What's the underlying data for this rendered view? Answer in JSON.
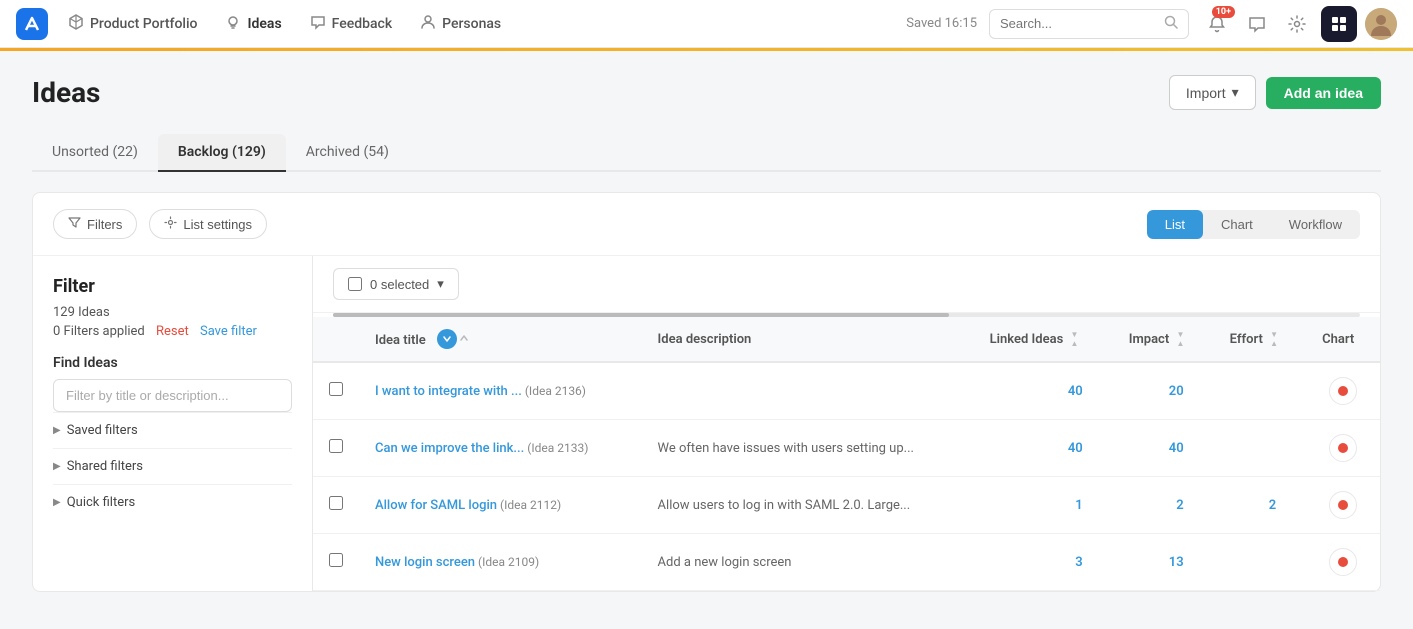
{
  "app": {
    "logo_label": "Aha",
    "nav_items": [
      {
        "label": "Product Portfolio",
        "icon": "cube-icon",
        "active": false
      },
      {
        "label": "Ideas",
        "icon": "bulb-icon",
        "active": true
      },
      {
        "label": "Feedback",
        "icon": "chat-icon",
        "active": false
      },
      {
        "label": "Personas",
        "icon": "person-icon",
        "active": false
      }
    ],
    "saved_text": "Saved 16:15",
    "search_placeholder": "Search...",
    "notification_badge": "10+",
    "user_avatar_alt": "User avatar"
  },
  "page": {
    "title": "Ideas",
    "btn_import": "Import",
    "btn_import_arrow": "▾",
    "btn_add_idea": "Add an idea"
  },
  "tabs": [
    {
      "label": "Unsorted (22)",
      "active": false
    },
    {
      "label": "Backlog (129)",
      "active": true
    },
    {
      "label": "Archived (54)",
      "active": false
    }
  ],
  "toolbar": {
    "btn_filters": "Filters",
    "btn_list_settings": "List settings",
    "view_buttons": [
      {
        "label": "List",
        "active": true
      },
      {
        "label": "Chart",
        "active": false
      },
      {
        "label": "Workflow",
        "active": false
      }
    ]
  },
  "filter_panel": {
    "title": "Filter",
    "ideas_count": "129 Ideas",
    "filters_applied": "0 Filters applied",
    "btn_reset": "Reset",
    "btn_save_filter": "Save filter",
    "find_ideas_label": "Find Ideas",
    "find_ideas_placeholder": "Filter by title or description...",
    "collapsibles": [
      {
        "label": "Saved filters"
      },
      {
        "label": "Shared filters"
      },
      {
        "label": "Quick filters"
      }
    ]
  },
  "table": {
    "selected_label": "0 selected",
    "selected_arrow": "▾",
    "columns": [
      {
        "label": "Idea title",
        "sort": true
      },
      {
        "label": "Idea description",
        "sort": false
      },
      {
        "label": "Linked Ideas",
        "sort": true
      },
      {
        "label": "Impact",
        "sort": true
      },
      {
        "label": "Effort",
        "sort": true
      },
      {
        "label": "Chart",
        "sort": false
      }
    ],
    "rows": [
      {
        "title": "I want to integrate with ...",
        "idea_id": "(Idea 2136)",
        "description": "",
        "linked_ideas": "40",
        "impact": "20",
        "effort": "",
        "has_chart": true
      },
      {
        "title": "Can we improve the link...",
        "idea_id": "(Idea 2133)",
        "description": "We often have issues with users setting up...",
        "linked_ideas": "40",
        "impact": "40",
        "effort": "",
        "has_chart": true
      },
      {
        "title": "Allow for SAML login",
        "idea_id": "(Idea 2112)",
        "description": "Allow users to log in with SAML 2.0. Large...",
        "linked_ideas": "1",
        "impact": "2",
        "effort": "2",
        "has_chart": true
      },
      {
        "title": "New login screen",
        "idea_id": "(Idea 2109)",
        "description": "Add a new login screen",
        "linked_ideas": "3",
        "impact": "13",
        "effort": "",
        "has_chart": true
      }
    ]
  },
  "colors": {
    "accent_blue": "#3498db",
    "accent_green": "#27ae60",
    "accent_red": "#e74c3c",
    "accent_yellow": "#f5a623",
    "nav_bg": "#ffffff",
    "sidebar_bg": "#ffffff"
  }
}
